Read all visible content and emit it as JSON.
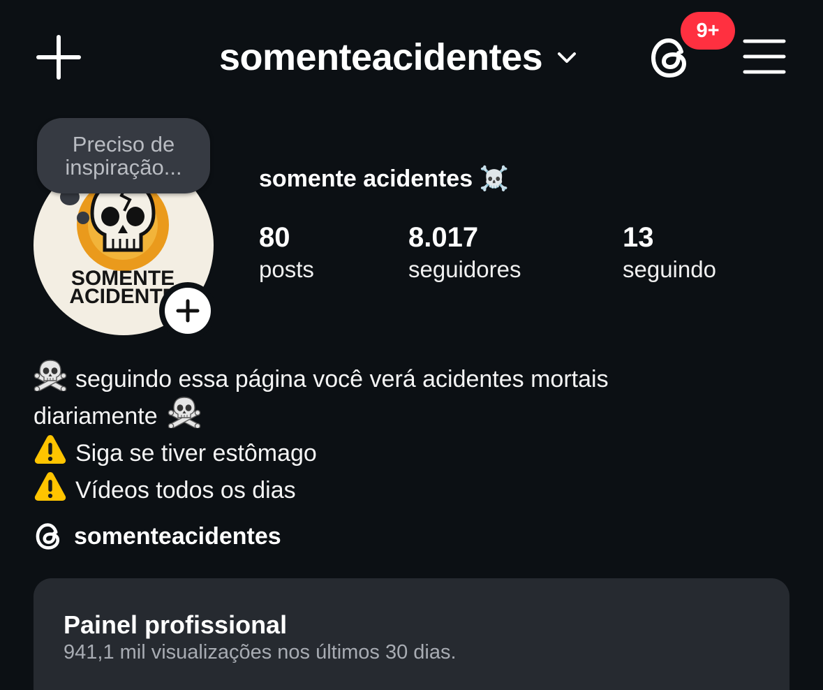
{
  "header": {
    "username": "somenteacidentes",
    "notification_badge": "9+"
  },
  "profile": {
    "note": "Preciso de inspiração...",
    "avatar_text_line1": "SOMENTE",
    "avatar_text_line2": "ACIDENTE",
    "display_name": "somente acidentes ☠️"
  },
  "stats": [
    {
      "value": "80",
      "label": "posts"
    },
    {
      "value": "8.017",
      "label": "seguidores"
    },
    {
      "value": "13",
      "label": "seguindo"
    }
  ],
  "bio": {
    "line1": "seguindo essa página você verá acidentes mortais",
    "line2": "diariamente",
    "line3": "Siga se tiver estômago",
    "line4": "Vídeos todos os dias"
  },
  "threads_link": {
    "label": "somenteacidentes"
  },
  "dashboard": {
    "title": "Painel profissional",
    "subtitle": "941,1 mil visualizações nos últimos 30 dias."
  },
  "colors": {
    "background": "#0c1014",
    "badge": "#ff3040",
    "card": "#262a30",
    "note_bubble": "#363a42"
  },
  "icons": [
    "plus-icon",
    "chevron-down-icon",
    "threads-icon",
    "menu-icon",
    "skull-crossbones-emoji",
    "warning-emoji"
  ]
}
